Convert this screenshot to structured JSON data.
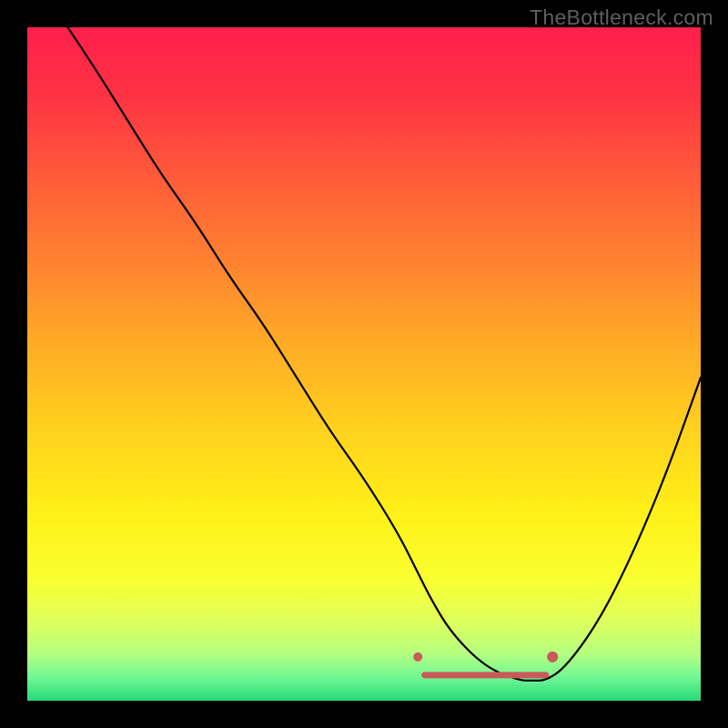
{
  "watermark": "TheBottleneck.com",
  "chart_data": {
    "type": "line",
    "title": "",
    "xlabel": "",
    "ylabel": "",
    "xlim": [
      0,
      100
    ],
    "ylim": [
      0,
      100
    ],
    "series": [
      {
        "name": "bottleneck-curve",
        "x": [
          6,
          10,
          15,
          20,
          25,
          30,
          35,
          40,
          45,
          50,
          55,
          58,
          60,
          63,
          68,
          73,
          75,
          77,
          80,
          85,
          90,
          95,
          100
        ],
        "y": [
          100,
          94,
          86,
          78,
          71,
          63,
          56,
          48,
          40,
          33,
          25,
          19,
          15,
          10,
          5,
          3,
          3,
          3,
          5,
          12,
          22,
          34,
          48
        ]
      }
    ],
    "markers": [
      {
        "name": "optimal-start-marker",
        "x": 58,
        "y": 6.5,
        "color": "#c85a5a",
        "r": 5
      },
      {
        "name": "optimal-end-marker",
        "x": 78,
        "y": 6.5,
        "color": "#c85a5a",
        "r": 6
      }
    ],
    "optimal_band": {
      "x_start": 59,
      "x_end": 77,
      "y": 3.8,
      "color": "#c85a5a",
      "thickness": 7
    },
    "background_gradient": {
      "stops": [
        {
          "offset": 0.0,
          "color": "#ff1f4c"
        },
        {
          "offset": 0.1,
          "color": "#ff3244"
        },
        {
          "offset": 0.22,
          "color": "#ff5a3a"
        },
        {
          "offset": 0.35,
          "color": "#ff8330"
        },
        {
          "offset": 0.48,
          "color": "#ffae26"
        },
        {
          "offset": 0.6,
          "color": "#ffd21e"
        },
        {
          "offset": 0.72,
          "color": "#fff018"
        },
        {
          "offset": 0.82,
          "color": "#f9ff30"
        },
        {
          "offset": 0.88,
          "color": "#e0ff5a"
        },
        {
          "offset": 0.93,
          "color": "#b5ff80"
        },
        {
          "offset": 0.965,
          "color": "#71f793"
        },
        {
          "offset": 1.0,
          "color": "#28d97a"
        }
      ]
    }
  }
}
